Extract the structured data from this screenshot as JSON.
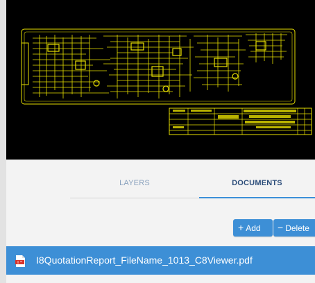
{
  "viewer": {
    "description_icon": "pcb-drawing",
    "board_color": "#e8e000"
  },
  "tabs": [
    {
      "label": "LAYERS",
      "active": false
    },
    {
      "label": "DOCUMENTS",
      "active": true
    }
  ],
  "toolbar": {
    "add_label": "Add",
    "add_icon": "plus-icon",
    "delete_label": "Delete",
    "delete_icon": "minus-icon"
  },
  "documents": [
    {
      "name": "I8QuotationReport_FileName_1013_C8Viewer.pdf",
      "icon": "pdf-icon",
      "selected": true
    }
  ],
  "colors": {
    "accent": "#3d8fd6",
    "tab_active_text": "#2c4d7a",
    "tab_inactive_text": "#8aa2be",
    "viewer_bg": "#000000"
  }
}
